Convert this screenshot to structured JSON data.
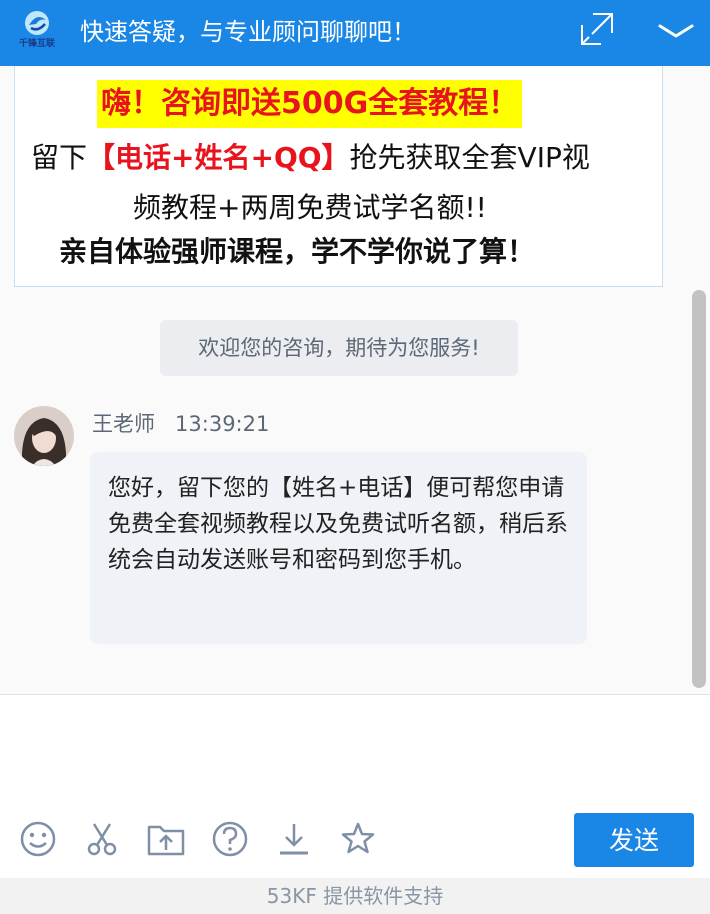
{
  "header": {
    "logo_text": "千锋互联",
    "title": "快速答疑，与专业顾问聊聊吧！"
  },
  "banner": {
    "line1": "嗨！咨询即送500G全套教程！",
    "line2_prefix": "留下",
    "line2_highlight": "【电话+姓名+QQ】",
    "line2_suffix": "抢先获取全套VIP视",
    "line3": "频教程+两周免费试学名额!!",
    "line4": "亲自体验强师课程，学不学你说了算！"
  },
  "chat": {
    "welcome": "欢迎您的咨询，期待为您服务!",
    "sender_name": "王老师",
    "sender_time": "13:39:21",
    "message": "您好，留下您的【姓名+电话】便可帮您申请免费全套视频教程以及免费试听名额，稍后系统会自动发送账号和密码到您手机。"
  },
  "toolbar": {
    "icons": [
      "emoji-icon",
      "scissors-icon",
      "upload-folder-icon",
      "help-icon",
      "download-icon",
      "star-icon"
    ],
    "send_label": "发送"
  },
  "footer": {
    "text": "53KF 提供软件支持"
  },
  "colors": {
    "primary": "#1a87e6",
    "banner_red": "#e8141d",
    "banner_highlight": "#ffff00"
  }
}
